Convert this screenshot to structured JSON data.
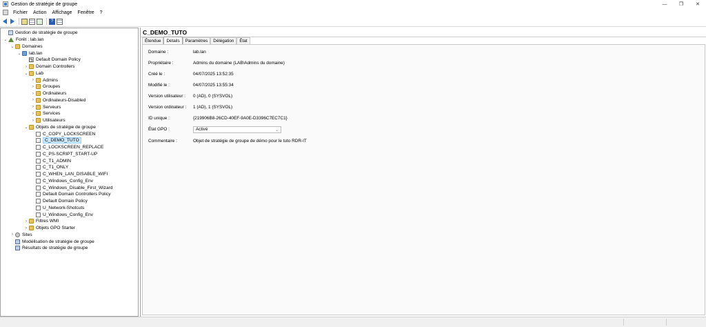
{
  "window": {
    "title": "Gestion de stratégie de groupe",
    "minimize": "—",
    "maximize": "❐",
    "close": "✕"
  },
  "menu": [
    "Fichier",
    "Action",
    "Affichage",
    "Fenêtre",
    "?"
  ],
  "tree": [
    {
      "label": "Gestion de stratégie de groupe",
      "icon": "root-icon",
      "level": 0,
      "toggle": ""
    },
    {
      "label": "Forêt : lab.lan",
      "icon": "forest-icon",
      "level": 0,
      "toggle": "v"
    },
    {
      "label": "Domaines",
      "icon": "folder-icon",
      "level": 1,
      "toggle": "v"
    },
    {
      "label": "lab.lan",
      "icon": "domain-icon",
      "level": 2,
      "toggle": "v"
    },
    {
      "label": "Default Domain Policy",
      "icon": "gpo-link-icon",
      "level": 3,
      "toggle": ""
    },
    {
      "label": "Domain Controllers",
      "icon": "folder-icon",
      "level": 3,
      "toggle": ">"
    },
    {
      "label": "Lab",
      "icon": "folder-icon",
      "level": 3,
      "toggle": "v"
    },
    {
      "label": "Admins",
      "icon": "folder-icon",
      "level": 4,
      "toggle": ">"
    },
    {
      "label": "Groupes",
      "icon": "folder-icon",
      "level": 4,
      "toggle": ">"
    },
    {
      "label": "Ordinateurs",
      "icon": "folder-icon",
      "level": 4,
      "toggle": ">"
    },
    {
      "label": "Ordinateurs-Disabled",
      "icon": "folder-icon",
      "level": 4,
      "toggle": ">"
    },
    {
      "label": "Serveurs",
      "icon": "folder-icon",
      "level": 4,
      "toggle": ">"
    },
    {
      "label": "Services",
      "icon": "folder-icon",
      "level": 4,
      "toggle": ">"
    },
    {
      "label": "Utilisateurs",
      "icon": "folder-icon",
      "level": 4,
      "toggle": ">"
    },
    {
      "label": "Objets de stratégie de groupe",
      "icon": "folder-icon",
      "level": 3,
      "toggle": "v"
    },
    {
      "label": "C_COPY_LOCKSCREEN",
      "icon": "gpo-icon",
      "level": 4,
      "toggle": ""
    },
    {
      "label": "C_DEMO_TUTO",
      "icon": "gpo-icon",
      "level": 4,
      "toggle": "",
      "selected": true
    },
    {
      "label": "C_LOCKSCREEN_REPLACE",
      "icon": "gpo-icon",
      "level": 4,
      "toggle": ""
    },
    {
      "label": "C_PS-SCRIPT_START-UP",
      "icon": "gpo-icon",
      "level": 4,
      "toggle": ""
    },
    {
      "label": "C_T1_ADMIN",
      "icon": "gpo-icon",
      "level": 4,
      "toggle": ""
    },
    {
      "label": "C_T1_ONLY",
      "icon": "gpo-icon",
      "level": 4,
      "toggle": ""
    },
    {
      "label": "C_WHEN_LAN_DISABLE_WIFI",
      "icon": "gpo-icon",
      "level": 4,
      "toggle": ""
    },
    {
      "label": "C_Windows_Config_Env",
      "icon": "gpo-icon",
      "level": 4,
      "toggle": ""
    },
    {
      "label": "C_Windows_Disable_First_Wizard",
      "icon": "gpo-icon",
      "level": 4,
      "toggle": ""
    },
    {
      "label": "Default Domain Controllers Policy",
      "icon": "gpo-icon",
      "level": 4,
      "toggle": ""
    },
    {
      "label": "Default Domain Policy",
      "icon": "gpo-icon",
      "level": 4,
      "toggle": ""
    },
    {
      "label": "U_Network-Shotcuts",
      "icon": "gpo-icon",
      "level": 4,
      "toggle": ""
    },
    {
      "label": "U_Windows_Config_Env",
      "icon": "gpo-icon",
      "level": 4,
      "toggle": ""
    },
    {
      "label": "Filtres WMI",
      "icon": "folder-icon",
      "level": 3,
      "toggle": ">"
    },
    {
      "label": "Objets GPO Starter",
      "icon": "folder-icon",
      "level": 3,
      "toggle": ">"
    },
    {
      "label": "Sites",
      "icon": "site-icon",
      "level": 1,
      "toggle": ">"
    },
    {
      "label": "Modélisation de stratégie de groupe",
      "icon": "model-icon",
      "level": 1,
      "toggle": ""
    },
    {
      "label": "Résultats de stratégie de groupe",
      "icon": "model-icon",
      "level": 1,
      "toggle": ""
    }
  ],
  "details": {
    "title": "C_DEMO_TUTO",
    "tabs": [
      "Étendue",
      "Détails",
      "Paramètres",
      "Délégation",
      "État"
    ],
    "active_tab": "Détails",
    "fields": [
      {
        "label": "Domaine :",
        "value": "lab.lan"
      },
      {
        "label": "Propriétaire :",
        "value": "Admins du domaine (LAB\\Admins du domaine)"
      },
      {
        "label": "Créé le :",
        "value": "04/07/2025 13:52:35"
      },
      {
        "label": "Modifié le :",
        "value": "04/07/2025 13:55:34"
      },
      {
        "label": "Version utilisateur :",
        "value": "0 (AD), 0 (SYSVOL)"
      },
      {
        "label": "Version ordinateur :",
        "value": "1 (AD), 1 (SYSVOL)"
      },
      {
        "label": "ID unique :",
        "value": "{219906B8-26CD-40EF-9A0E-D3396C7EC7C1}"
      }
    ],
    "gpo_status_label": "État GPO :",
    "gpo_status_value": "Activé",
    "comment_label": "Commentaire :",
    "comment_value": "Objet de stratégie de groupe de démo pour le tuto RDR-IT"
  }
}
